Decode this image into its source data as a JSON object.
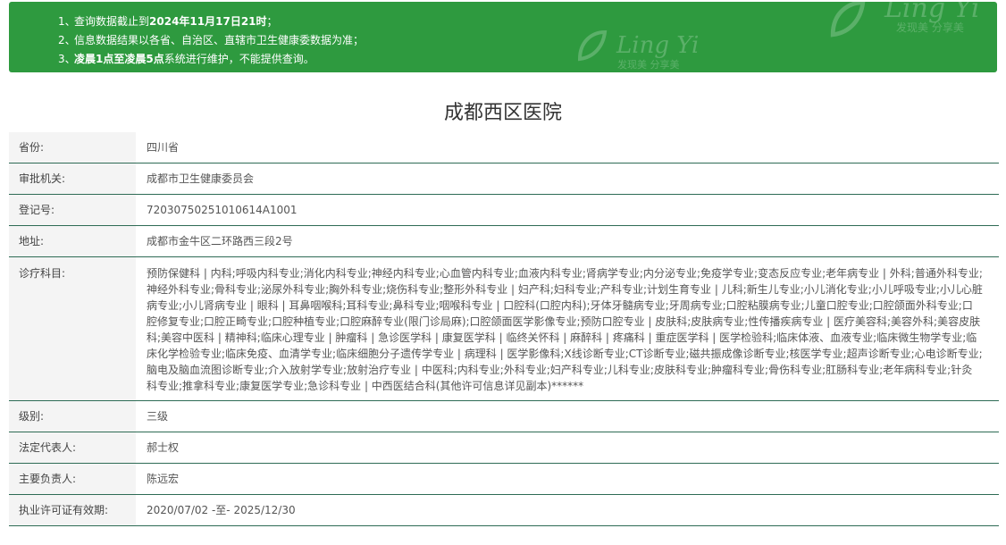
{
  "notice": {
    "items": [
      {
        "num": "1、",
        "prefix": "查询数据截止到",
        "bold": "2024年11月17日21时",
        "suffix": "；"
      },
      {
        "num": "2、",
        "prefix": "信息数据结果以各省、自治区、直辖市卫生健康委数据为准；",
        "bold": "",
        "suffix": ""
      },
      {
        "num": "3、",
        "prefix": "",
        "bold": "凌晨1点至凌晨5点",
        "suffix": "系统进行维护，不能提供查询。"
      }
    ],
    "watermark": {
      "brand": "Ling Yi",
      "slogan": "发现美 分享美"
    }
  },
  "hospital": {
    "name": "成都西区医院"
  },
  "fields": {
    "province": {
      "label": "省份:",
      "value": "四川省"
    },
    "approval": {
      "label": "审批机关:",
      "value": "成都市卫生健康委员会"
    },
    "registration": {
      "label": "登记号:",
      "value": "72030750251010614A1001"
    },
    "address": {
      "label": "地址:",
      "value": "成都市金牛区二环路西三段2号"
    },
    "departments": {
      "label": "诊疗科目:",
      "value": "预防保健科 | 内科;呼吸内科专业;消化内科专业;神经内科专业;心血管内科专业;血液内科专业;肾病学专业;内分泌专业;免疫学专业;变态反应专业;老年病专业 | 外科;普通外科专业;神经外科专业;骨科专业;泌尿外科专业;胸外科专业;烧伤科专业;整形外科专业 | 妇产科;妇科专业;产科专业;计划生育专业 | 儿科;新生儿专业;小儿消化专业;小儿呼吸专业;小儿心脏病专业;小儿肾病专业 | 眼科 | 耳鼻咽喉科;耳科专业;鼻科专业;咽喉科专业 | 口腔科(口腔内科);牙体牙髓病专业;牙周病专业;口腔粘膜病专业;儿童口腔专业;口腔颌面外科专业;口腔修复专业;口腔正畸专业;口腔种植专业;口腔麻醉专业(限门诊局麻);口腔颌面医学影像专业;预防口腔专业 | 皮肤科;皮肤病专业;性传播疾病专业 | 医疗美容科;美容外科;美容皮肤科;美容中医科 | 精神科;临床心理专业 | 肿瘤科 | 急诊医学科 | 康复医学科 | 临终关怀科 | 麻醉科 | 疼痛科 | 重症医学科 | 医学检验科;临床体液、血液专业;临床微生物学专业;临床化学检验专业;临床免疫、血清学专业;临床细胞分子遗传学专业 | 病理科 | 医学影像科;X线诊断专业;CT诊断专业;磁共振成像诊断专业;核医学专业;超声诊断专业;心电诊断专业;脑电及脑血流图诊断专业;介入放射学专业;放射治疗专业 | 中医科;内科专业;外科专业;妇产科专业;儿科专业;皮肤科专业;肿瘤科专业;骨伤科专业;肛肠科专业;老年病科专业;针灸科专业;推拿科专业;康复医学专业;急诊科专业 | 中西医结合科(其他许可信息详见副本)******"
    },
    "level": {
      "label": "级别:",
      "value": "三级"
    },
    "legal_rep": {
      "label": "法定代表人:",
      "value": "郝士权"
    },
    "principal": {
      "label": "主要负责人:",
      "value": "陈远宏"
    },
    "license_validity": {
      "label": "执业许可证有效期:",
      "value": "2020/07/02 -至- 2025/12/30"
    }
  }
}
